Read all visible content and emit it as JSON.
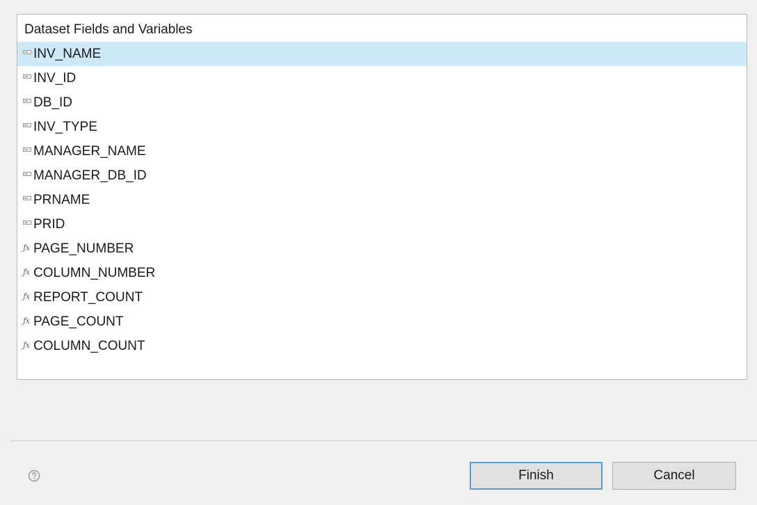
{
  "list": {
    "header": "Dataset Fields and Variables",
    "selected_index": 0,
    "items": [
      {
        "label": "INV_NAME",
        "kind": "field",
        "icon": "field-icon"
      },
      {
        "label": "INV_ID",
        "kind": "field",
        "icon": "field-icon"
      },
      {
        "label": "DB_ID",
        "kind": "field",
        "icon": "field-icon"
      },
      {
        "label": "INV_TYPE",
        "kind": "field",
        "icon": "field-icon"
      },
      {
        "label": "MANAGER_NAME",
        "kind": "field",
        "icon": "field-icon"
      },
      {
        "label": "MANAGER_DB_ID",
        "kind": "field",
        "icon": "field-icon"
      },
      {
        "label": "PRNAME",
        "kind": "field",
        "icon": "field-icon"
      },
      {
        "label": "PRID",
        "kind": "field",
        "icon": "field-icon"
      },
      {
        "label": "PAGE_NUMBER",
        "kind": "variable",
        "icon": "fx-icon"
      },
      {
        "label": "COLUMN_NUMBER",
        "kind": "variable",
        "icon": "fx-icon"
      },
      {
        "label": "REPORT_COUNT",
        "kind": "variable",
        "icon": "fx-icon"
      },
      {
        "label": "PAGE_COUNT",
        "kind": "variable",
        "icon": "fx-icon"
      },
      {
        "label": "COLUMN_COUNT",
        "kind": "variable",
        "icon": "fx-icon"
      }
    ]
  },
  "footer": {
    "help_icon": "help-icon",
    "finish_label": "Finish",
    "cancel_label": "Cancel"
  },
  "colors": {
    "selection": "#cde8f7",
    "default_button_border": "#5b9bd5",
    "background": "#f0f0f0"
  }
}
